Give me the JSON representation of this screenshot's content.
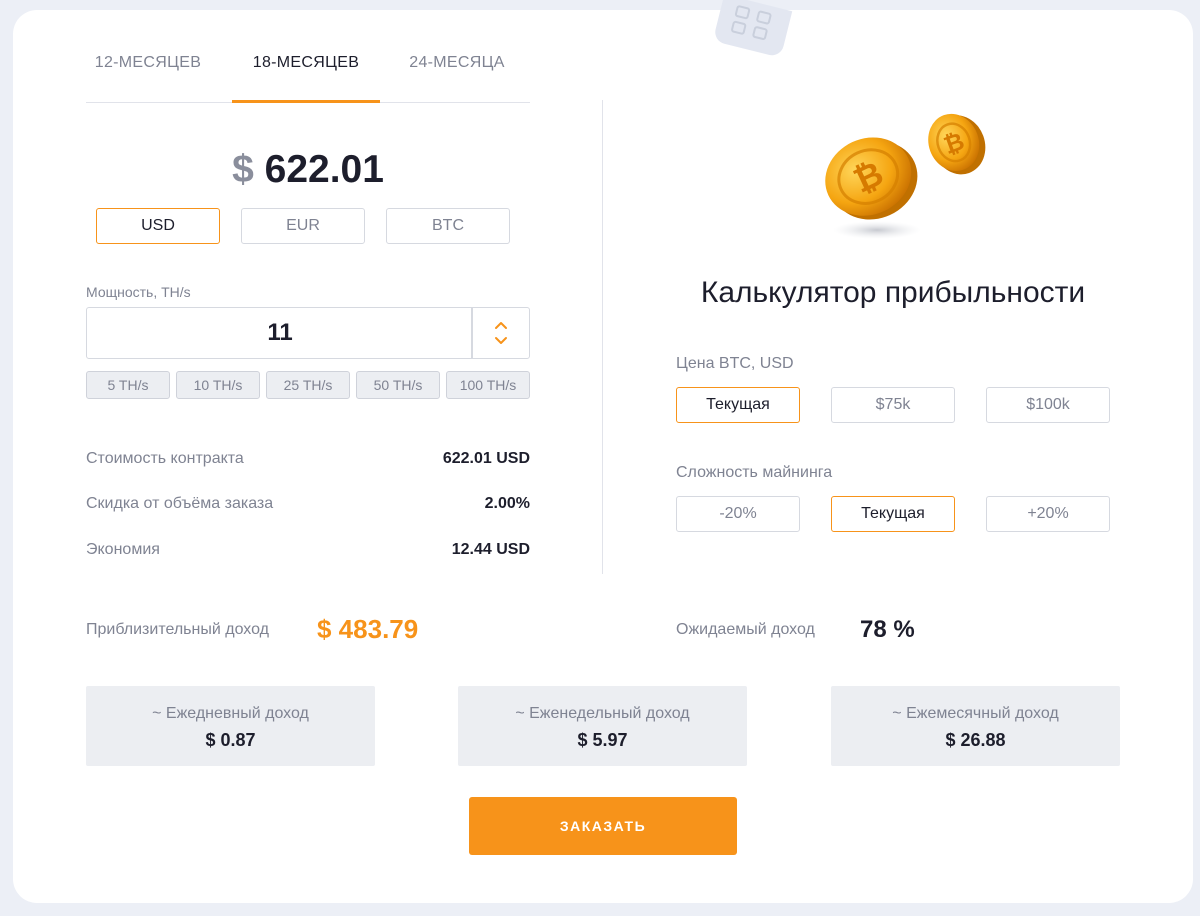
{
  "colors": {
    "accent": "#f7931a",
    "background": "#eceff6",
    "card": "#ffffff",
    "muted_text": "#7f8392",
    "box": "#eceef2"
  },
  "tabs": [
    {
      "label": "12-МЕСЯЦЕВ",
      "active": false
    },
    {
      "label": "18-МЕСЯЦЕВ",
      "active": true
    },
    {
      "label": "24-МЕСЯЦА",
      "active": false
    }
  ],
  "price": {
    "symbol": "$",
    "value": "622.01"
  },
  "currencies": [
    {
      "label": "USD",
      "selected": true
    },
    {
      "label": "EUR",
      "selected": false
    },
    {
      "label": "BTC",
      "selected": false
    }
  ],
  "power": {
    "label": "Мощность, TH/s",
    "value": "11",
    "stepper_icon": "chevron-up-down-icon",
    "presets": [
      "5 TH/s",
      "10 TH/s",
      "25 TH/s",
      "50 TH/s",
      "100 TH/s"
    ]
  },
  "summary": [
    {
      "label": "Стоимость контракта",
      "value": "622.01 USD"
    },
    {
      "label": "Скидка от объёма заказа",
      "value": "2.00%"
    },
    {
      "label": "Экономия",
      "value": "12.44 USD"
    }
  ],
  "calculator": {
    "title": "Калькулятор прибыльности",
    "illustration": "bitcoin-coins-icon",
    "btc_price": {
      "label": "Цена BTC, USD",
      "options": [
        {
          "label": "Текущая",
          "selected": true
        },
        {
          "label": "$75k",
          "selected": false
        },
        {
          "label": "$100k",
          "selected": false
        }
      ]
    },
    "difficulty": {
      "label": "Сложность майнинга",
      "options": [
        {
          "label": "-20%",
          "selected": false
        },
        {
          "label": "Текущая",
          "selected": true
        },
        {
          "label": "+20%",
          "selected": false
        }
      ]
    }
  },
  "income": {
    "approx_label": "Приблизительный доход",
    "approx_value": "$ 483.79",
    "expected_label": "Ожидаемый доход",
    "expected_value": "78 %"
  },
  "stats": [
    {
      "label": "~ Ежедневный доход",
      "value": "$ 0.87"
    },
    {
      "label": "~ Еженедельный доход",
      "value": "$ 5.97"
    },
    {
      "label": "~ Ежемесячный доход",
      "value": "$ 26.88"
    }
  ],
  "order_button": "ЗАКАЗАТЬ"
}
